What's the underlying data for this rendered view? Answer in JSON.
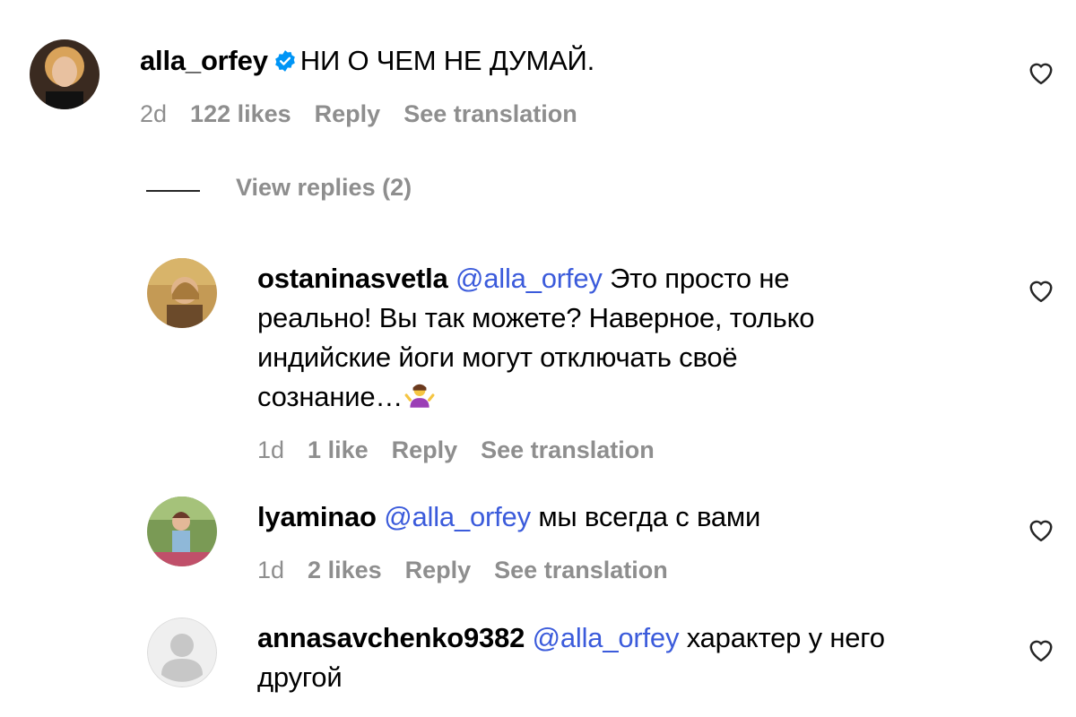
{
  "comments": [
    {
      "username": "alla_orfey",
      "verified": true,
      "text": "НИ О ЧЕМ НЕ ДУМАЙ.",
      "age": "2d",
      "likes": "122 likes",
      "reply": "Reply",
      "translate": "See translation"
    },
    {
      "username": "ostaninasvetla",
      "mention": "@alla_orfey",
      "text_line1": " Это просто не",
      "text_line2": "реально! Вы так можете? Наверное, только",
      "text_line3": "индийские йоги могут отключать своё",
      "text_line4": "сознание…",
      "emoji": "person-shrugging-emoji",
      "age": "1d",
      "likes": "1 like",
      "reply": "Reply",
      "translate": "See translation"
    },
    {
      "username": "lyaminao",
      "mention": "@alla_orfey",
      "text": " мы всегда с вами",
      "age": "1d",
      "likes": "2 likes",
      "reply": "Reply",
      "translate": "See translation"
    },
    {
      "username": "annasavchenko9382",
      "mention": "@alla_orfey",
      "text_line1": " характер у него",
      "text_line2": "другой"
    }
  ],
  "view_replies": "View replies (2)",
  "icons": {
    "like": "heart-outline-icon",
    "verified": "verified-badge-icon",
    "default_avatar": "default-avatar-icon"
  },
  "colors": {
    "mention": "#3b5bdb",
    "meta": "#8e8e8e",
    "verified": "#0095f6"
  }
}
